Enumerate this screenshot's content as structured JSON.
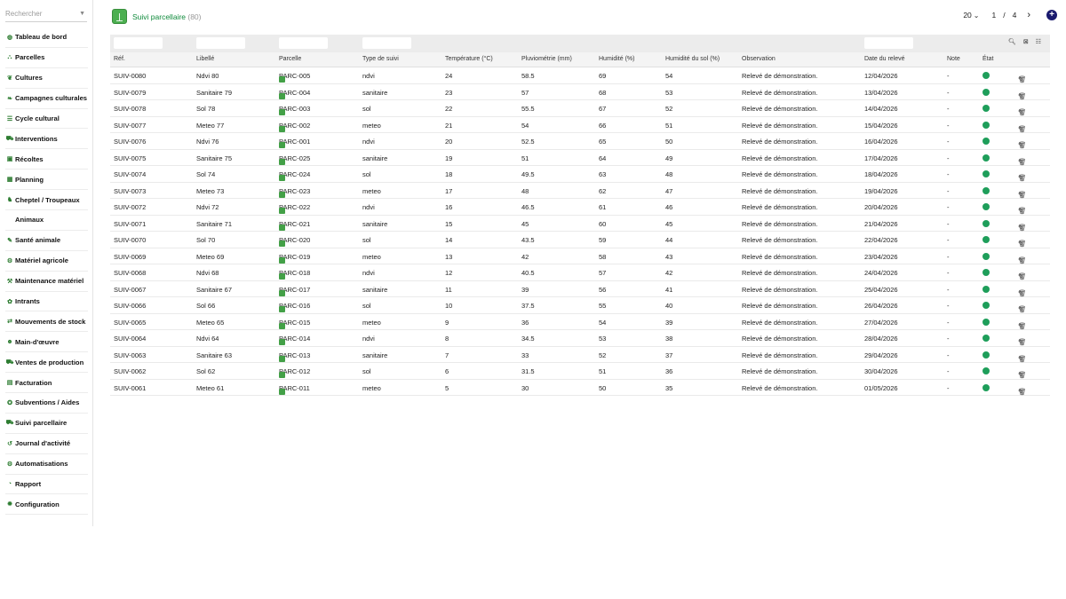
{
  "search": {
    "placeholder": "Rechercher"
  },
  "sidebar": {
    "items": [
      {
        "label": "Tableau de bord",
        "icon": "dashboard-icon",
        "glyph": "◍"
      },
      {
        "label": "Parcelles",
        "icon": "map-icon",
        "glyph": "⛬"
      },
      {
        "label": "Cultures",
        "icon": "sprout-icon",
        "glyph": "❦"
      },
      {
        "label": "Campagnes culturales",
        "icon": "leaf-icon",
        "glyph": "❧"
      },
      {
        "label": "Cycle cultural",
        "icon": "list-icon",
        "glyph": "☰"
      },
      {
        "label": "Interventions",
        "icon": "tractor-icon",
        "glyph": "⛟"
      },
      {
        "label": "Récoltes",
        "icon": "basket-icon",
        "glyph": "▣"
      },
      {
        "label": "Planning",
        "icon": "calendar-icon",
        "glyph": "▦"
      },
      {
        "label": "Cheptel / Troupeaux",
        "icon": "cow-icon",
        "glyph": "♞"
      },
      {
        "label": "Animaux",
        "icon": "",
        "glyph": "",
        "sub": true
      },
      {
        "label": "Santé animale",
        "icon": "syringe-icon",
        "glyph": "✎"
      },
      {
        "label": "Matériel agricole",
        "icon": "machine-icon",
        "glyph": "⚙"
      },
      {
        "label": "Maintenance matériel",
        "icon": "wrench-icon",
        "glyph": "⚒"
      },
      {
        "label": "Intrants",
        "icon": "seed-icon",
        "glyph": "✿"
      },
      {
        "label": "Mouvements de stock",
        "icon": "exchange-icon",
        "glyph": "⇄"
      },
      {
        "label": "Main-d'œuvre",
        "icon": "user-icon",
        "glyph": "☻"
      },
      {
        "label": "Ventes de production",
        "icon": "truck-icon",
        "glyph": "⛟"
      },
      {
        "label": "Facturation",
        "icon": "invoice-icon",
        "glyph": "▤"
      },
      {
        "label": "Subventions / Aides",
        "icon": "award-icon",
        "glyph": "✪"
      },
      {
        "label": "Suivi parcellaire",
        "icon": "tractor-icon",
        "glyph": "⛟"
      },
      {
        "label": "Journal d'activité",
        "icon": "history-icon",
        "glyph": "↺"
      },
      {
        "label": "Automatisations",
        "icon": "robot-icon",
        "glyph": "⚙"
      },
      {
        "label": "Rapport",
        "icon": "pie-chart-icon",
        "glyph": "◔"
      },
      {
        "label": "Configuration",
        "icon": "gear-icon",
        "glyph": "✹"
      }
    ]
  },
  "header": {
    "title": "Suivi parcellaire",
    "count": "(80)"
  },
  "pager": {
    "per_page": "20",
    "current": "1",
    "separator": "/",
    "total": "4"
  },
  "table": {
    "columns": [
      "Réf.",
      "Libellé",
      "Parcelle",
      "Type de suivi",
      "Température (°C)",
      "Pluviométrie (mm)",
      "Humidité (%)",
      "Humidité du sol (%)",
      "Observation",
      "Date du relevé",
      "Note",
      "État"
    ],
    "rows": [
      [
        "SUIV-0080",
        "Ndvi 80",
        "PARC-005",
        "ndvi",
        "24",
        "58.5",
        "69",
        "54",
        "Relevé de démonstration.",
        "12/04/2026",
        "-"
      ],
      [
        "SUIV-0079",
        "Sanitaire 79",
        "PARC-004",
        "sanitaire",
        "23",
        "57",
        "68",
        "53",
        "Relevé de démonstration.",
        "13/04/2026",
        "-"
      ],
      [
        "SUIV-0078",
        "Sol 78",
        "PARC-003",
        "sol",
        "22",
        "55.5",
        "67",
        "52",
        "Relevé de démonstration.",
        "14/04/2026",
        "-"
      ],
      [
        "SUIV-0077",
        "Meteo 77",
        "PARC-002",
        "meteo",
        "21",
        "54",
        "66",
        "51",
        "Relevé de démonstration.",
        "15/04/2026",
        "-"
      ],
      [
        "SUIV-0076",
        "Ndvi 76",
        "PARC-001",
        "ndvi",
        "20",
        "52.5",
        "65",
        "50",
        "Relevé de démonstration.",
        "16/04/2026",
        "-"
      ],
      [
        "SUIV-0075",
        "Sanitaire 75",
        "PARC-025",
        "sanitaire",
        "19",
        "51",
        "64",
        "49",
        "Relevé de démonstration.",
        "17/04/2026",
        "-"
      ],
      [
        "SUIV-0074",
        "Sol 74",
        "PARC-024",
        "sol",
        "18",
        "49.5",
        "63",
        "48",
        "Relevé de démonstration.",
        "18/04/2026",
        "-"
      ],
      [
        "SUIV-0073",
        "Meteo 73",
        "PARC-023",
        "meteo",
        "17",
        "48",
        "62",
        "47",
        "Relevé de démonstration.",
        "19/04/2026",
        "-"
      ],
      [
        "SUIV-0072",
        "Ndvi 72",
        "PARC-022",
        "ndvi",
        "16",
        "46.5",
        "61",
        "46",
        "Relevé de démonstration.",
        "20/04/2026",
        "-"
      ],
      [
        "SUIV-0071",
        "Sanitaire 71",
        "PARC-021",
        "sanitaire",
        "15",
        "45",
        "60",
        "45",
        "Relevé de démonstration.",
        "21/04/2026",
        "-"
      ],
      [
        "SUIV-0070",
        "Sol 70",
        "PARC-020",
        "sol",
        "14",
        "43.5",
        "59",
        "44",
        "Relevé de démonstration.",
        "22/04/2026",
        "-"
      ],
      [
        "SUIV-0069",
        "Meteo 69",
        "PARC-019",
        "meteo",
        "13",
        "42",
        "58",
        "43",
        "Relevé de démonstration.",
        "23/04/2026",
        "-"
      ],
      [
        "SUIV-0068",
        "Ndvi 68",
        "PARC-018",
        "ndvi",
        "12",
        "40.5",
        "57",
        "42",
        "Relevé de démonstration.",
        "24/04/2026",
        "-"
      ],
      [
        "SUIV-0067",
        "Sanitaire 67",
        "PARC-017",
        "sanitaire",
        "11",
        "39",
        "56",
        "41",
        "Relevé de démonstration.",
        "25/04/2026",
        "-"
      ],
      [
        "SUIV-0066",
        "Sol 66",
        "PARC-016",
        "sol",
        "10",
        "37.5",
        "55",
        "40",
        "Relevé de démonstration.",
        "26/04/2026",
        "-"
      ],
      [
        "SUIV-0065",
        "Meteo 65",
        "PARC-015",
        "meteo",
        "9",
        "36",
        "54",
        "39",
        "Relevé de démonstration.",
        "27/04/2026",
        "-"
      ],
      [
        "SUIV-0064",
        "Ndvi 64",
        "PARC-014",
        "ndvi",
        "8",
        "34.5",
        "53",
        "38",
        "Relevé de démonstration.",
        "28/04/2026",
        "-"
      ],
      [
        "SUIV-0063",
        "Sanitaire 63",
        "PARC-013",
        "sanitaire",
        "7",
        "33",
        "52",
        "37",
        "Relevé de démonstration.",
        "29/04/2026",
        "-"
      ],
      [
        "SUIV-0062",
        "Sol 62",
        "PARC-012",
        "sol",
        "6",
        "31.5",
        "51",
        "36",
        "Relevé de démonstration.",
        "30/04/2026",
        "-"
      ],
      [
        "SUIV-0061",
        "Meteo 61",
        "PARC-011",
        "meteo",
        "5",
        "30",
        "50",
        "35",
        "Relevé de démonstration.",
        "01/05/2026",
        "-"
      ]
    ]
  },
  "colors": {
    "accent": "#0e8a3a",
    "status_ok": "#1e9e5a",
    "link": "#1f2a66",
    "add_button": "#1a1a6e"
  }
}
